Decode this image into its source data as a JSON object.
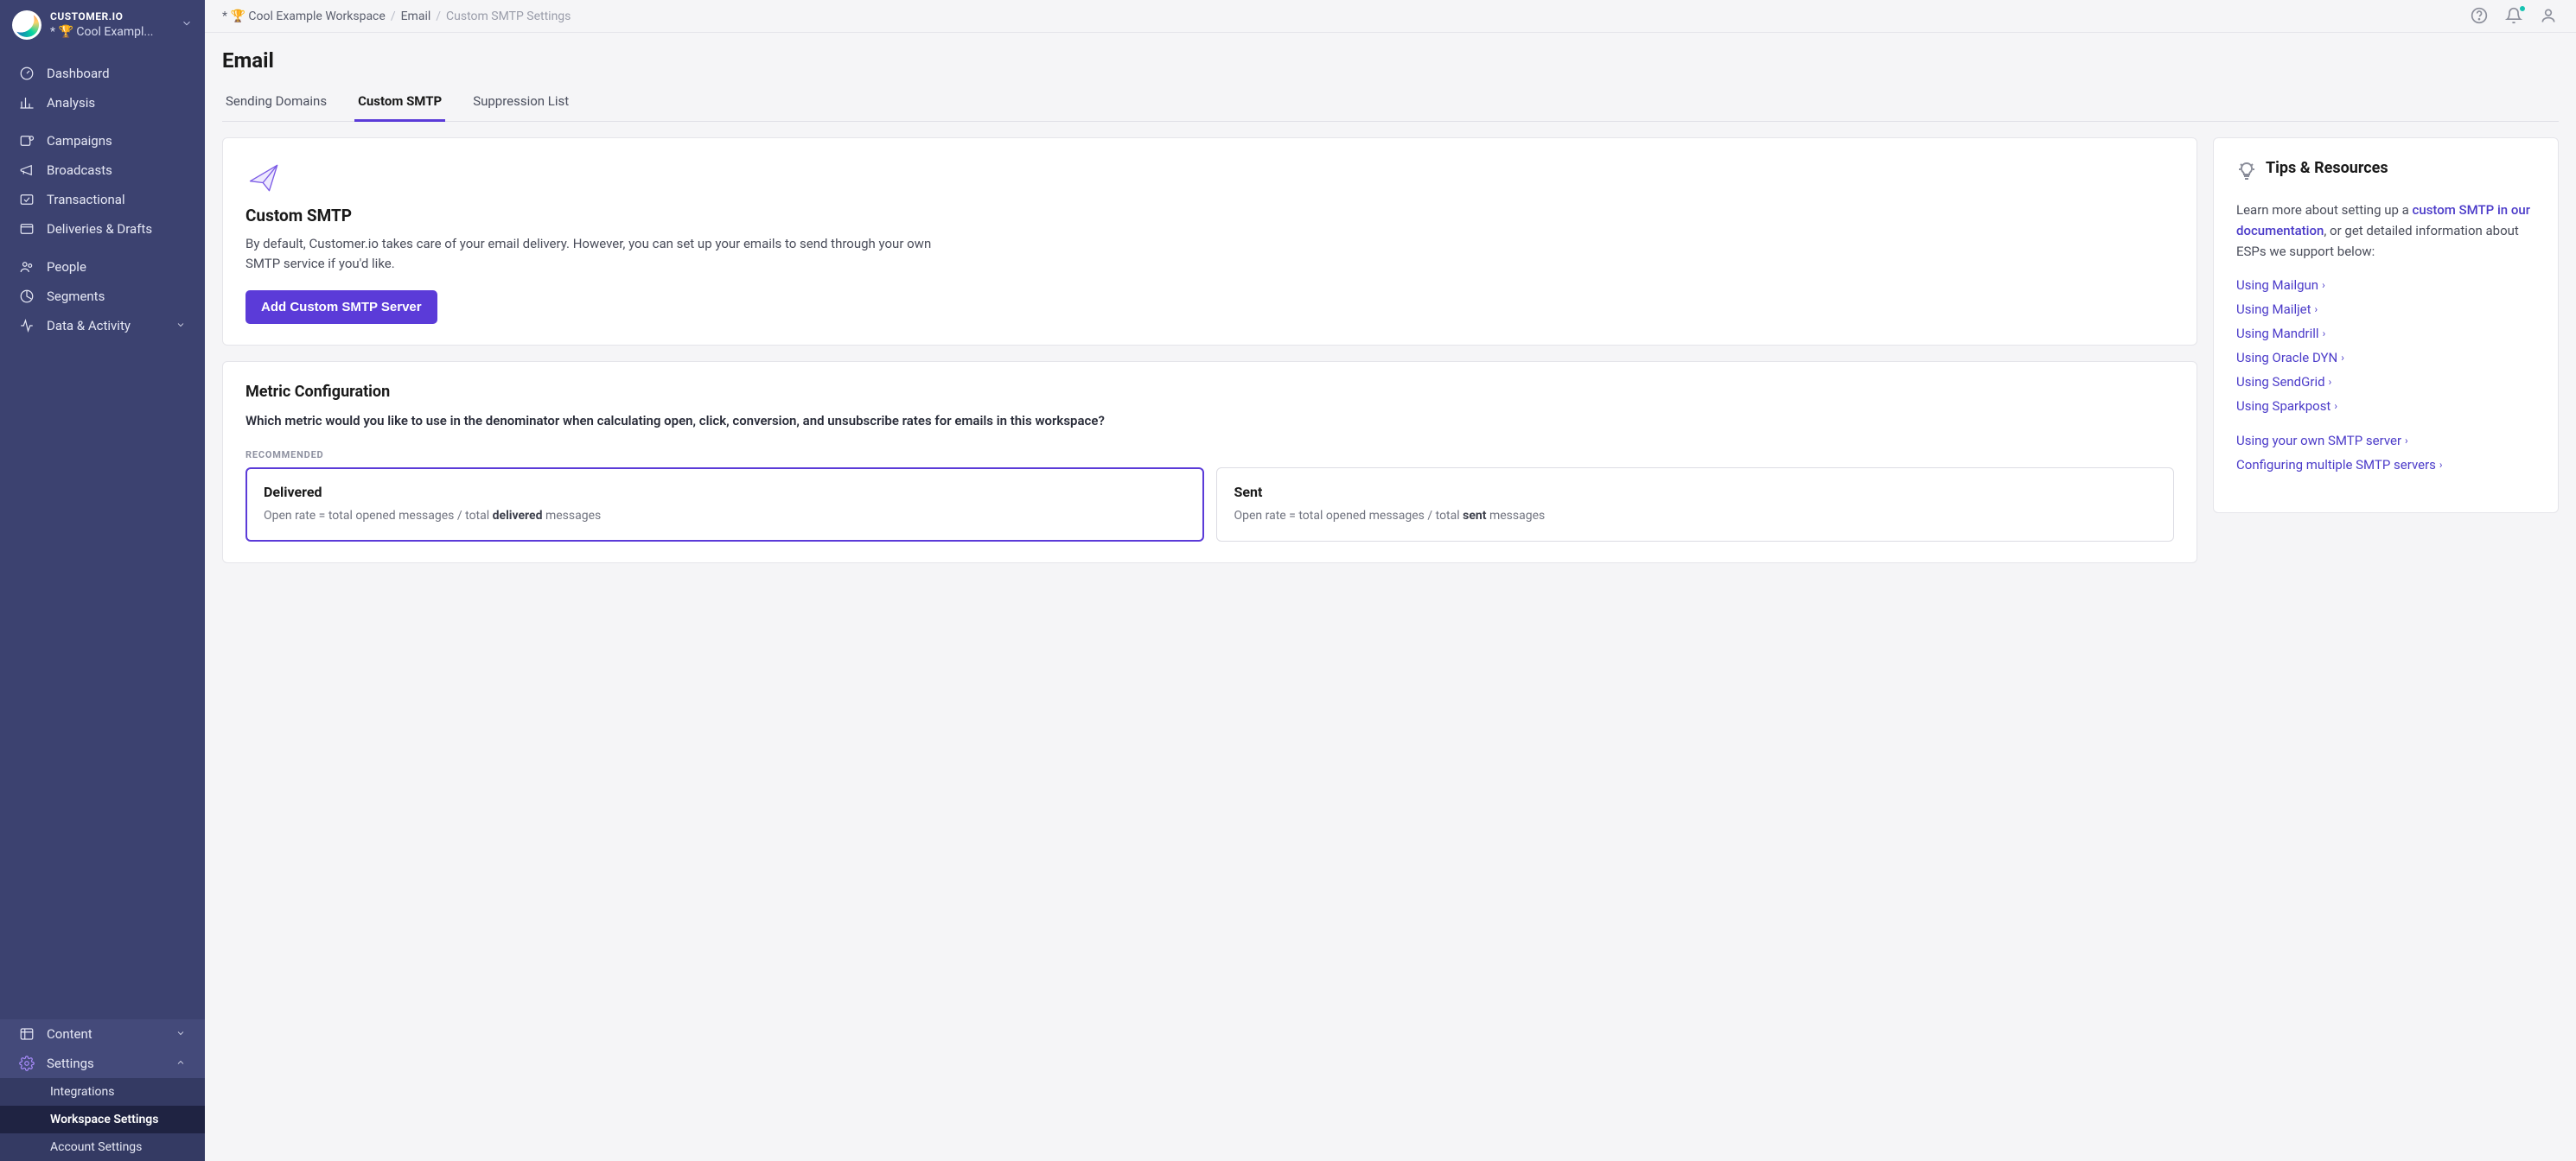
{
  "brand": "CUSTOMER.IO",
  "workspace_name": "* 🏆 Cool Exampl...",
  "sidebar": {
    "main": [
      {
        "icon": "gauge",
        "label": "Dashboard"
      },
      {
        "icon": "chart",
        "label": "Analysis"
      }
    ],
    "campaigns": [
      {
        "icon": "campaign",
        "label": "Campaigns"
      },
      {
        "icon": "megaphone",
        "label": "Broadcasts"
      },
      {
        "icon": "transactional",
        "label": "Transactional"
      },
      {
        "icon": "deliveries",
        "label": "Deliveries & Drafts"
      }
    ],
    "people": [
      {
        "icon": "people",
        "label": "People"
      },
      {
        "icon": "segments",
        "label": "Segments"
      },
      {
        "icon": "data",
        "label": "Data & Activity",
        "expandable": true
      }
    ],
    "bottom": [
      {
        "icon": "content",
        "label": "Content",
        "expandable": true
      },
      {
        "icon": "gear",
        "label": "Settings",
        "expandable": true,
        "expanded": true
      }
    ],
    "settings_sub": [
      {
        "label": "Integrations"
      },
      {
        "label": "Workspace Settings",
        "active": true
      },
      {
        "label": "Account Settings"
      }
    ]
  },
  "breadcrumb": {
    "items": [
      "* 🏆 Cool Example Workspace",
      "Email",
      "Custom SMTP Settings"
    ]
  },
  "page_title": "Email",
  "tabs": [
    {
      "label": "Sending Domains"
    },
    {
      "label": "Custom SMTP",
      "active": true
    },
    {
      "label": "Suppression List"
    }
  ],
  "smtp_card": {
    "title": "Custom SMTP",
    "description": "By default, Customer.io takes care of your email delivery. However, you can set up your emails to send through your own SMTP service if you'd like.",
    "button": "Add Custom SMTP Server"
  },
  "metric_card": {
    "title": "Metric Configuration",
    "question": "Which metric would you like to use in the denominator when calculating open, click, conversion, and unsubscribe rates for emails in this workspace?",
    "recommended_label": "RECOMMENDED",
    "options": [
      {
        "title": "Delivered",
        "desc_prefix": "Open rate = total opened messages / total ",
        "desc_bold": "delivered",
        "desc_suffix": " messages",
        "selected": true
      },
      {
        "title": "Sent",
        "desc_prefix": "Open rate = total opened messages / total ",
        "desc_bold": "sent",
        "desc_suffix": " messages",
        "selected": false
      }
    ]
  },
  "tips": {
    "title": "Tips & Resources",
    "intro_prefix": "Learn more about setting up a ",
    "intro_link": "custom SMTP in our documentation",
    "intro_suffix": ", or get detailed information about ESPs we support below:",
    "links_group1": [
      "Using Mailgun",
      "Using Mailjet",
      "Using Mandrill",
      "Using Oracle DYN",
      "Using SendGrid",
      "Using Sparkpost"
    ],
    "links_group2": [
      "Using your own SMTP server",
      "Configuring multiple SMTP servers"
    ]
  }
}
